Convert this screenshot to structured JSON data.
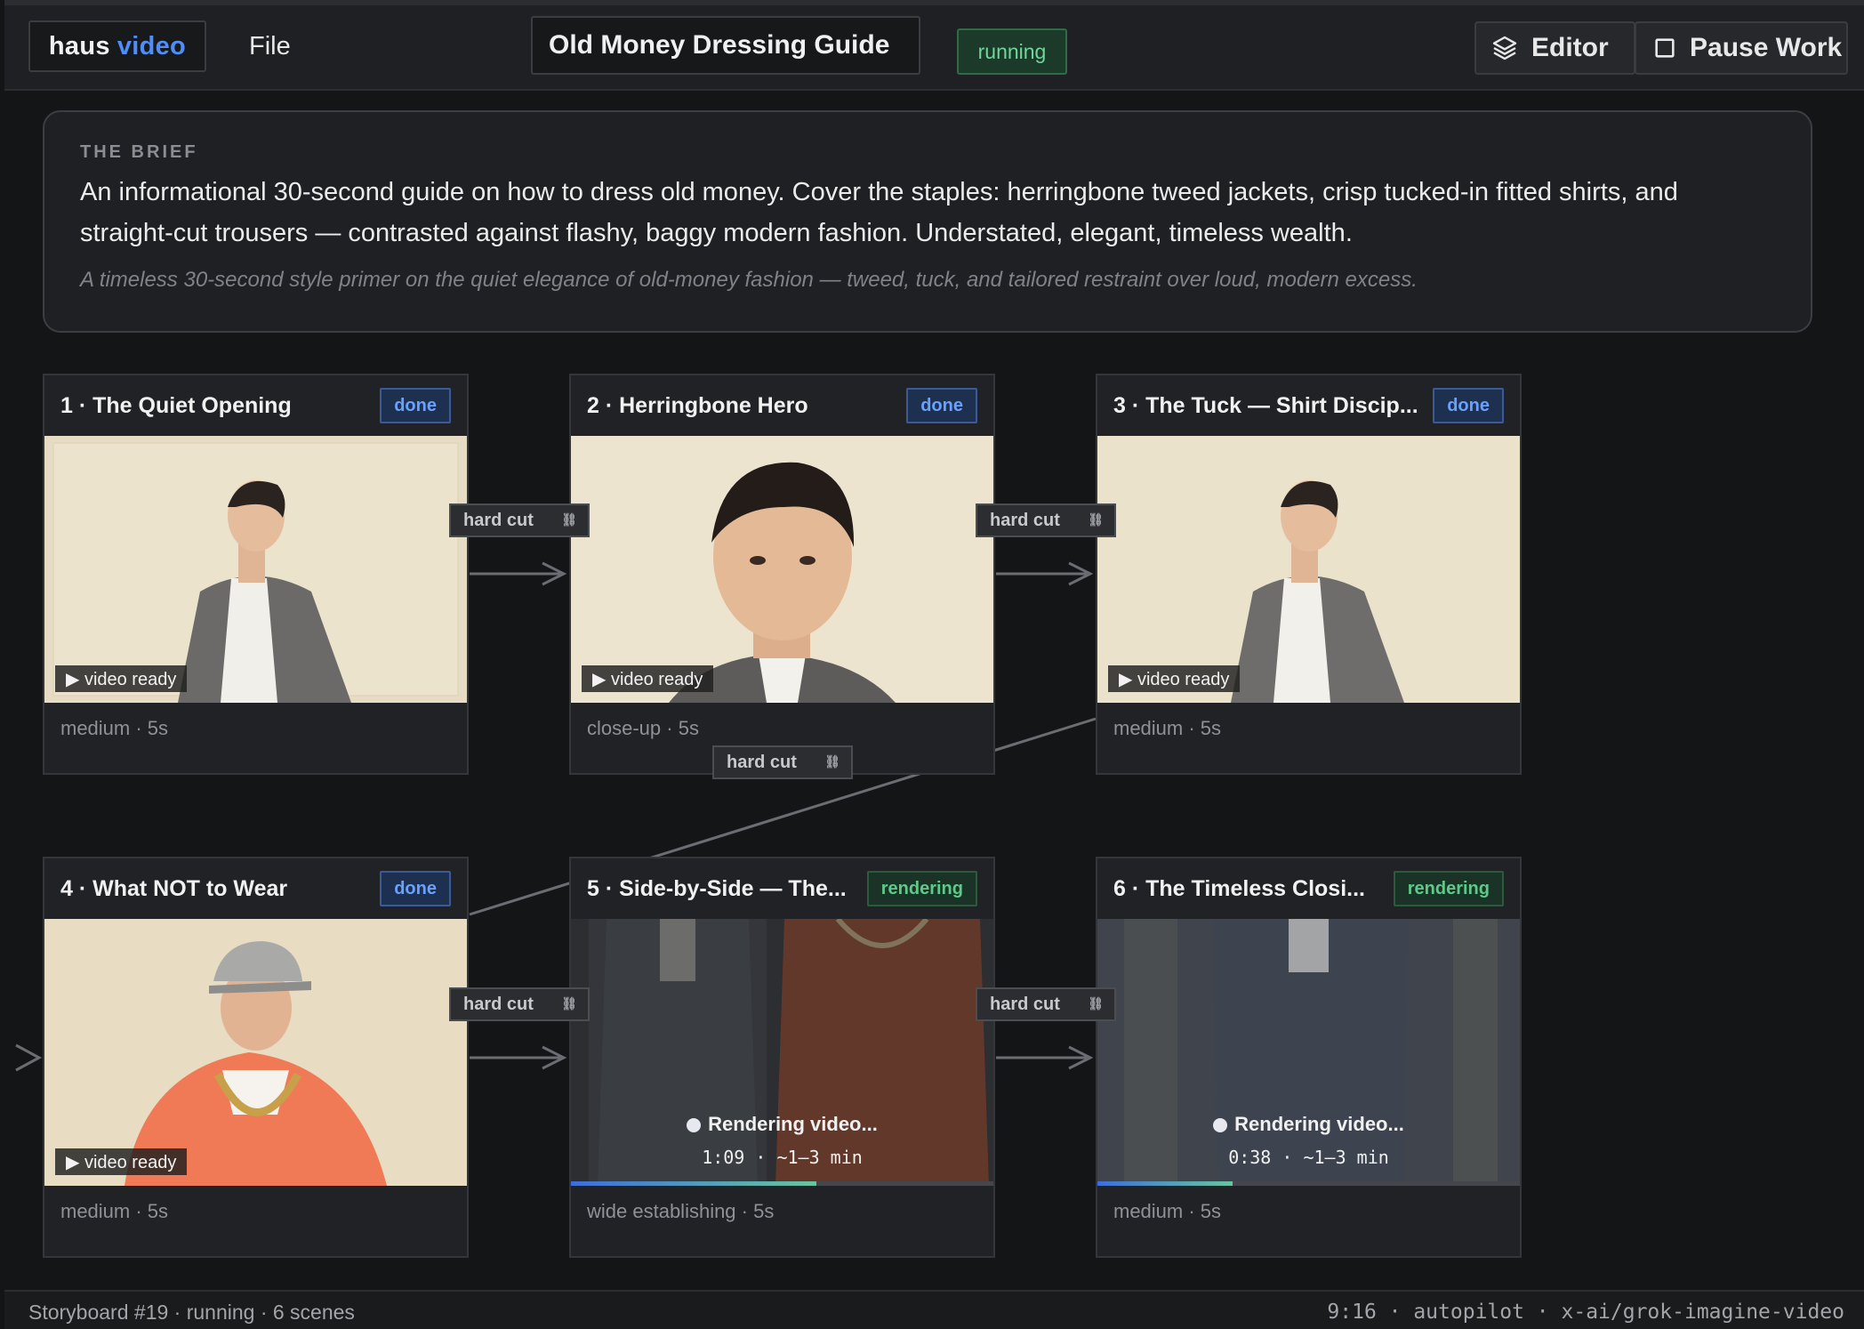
{
  "header": {
    "logo_a": "haus",
    "logo_b": "video",
    "menu_file": "File",
    "title": "Old Money Dressing Guide",
    "status": "running",
    "editor_label": "Editor",
    "pause_label": "Pause Work"
  },
  "brief": {
    "label": "THE BRIEF",
    "text": "An informational 30-second guide on how to dress old money. Cover the staples: herringbone tweed jackets, crisp tucked-in fitted shirts, and straight-cut trousers — contrasted against flashy, baggy modern fashion. Understated, elegant, timeless wealth.",
    "tagline": "A timeless 30-second style primer on the quiet elegance of old-money fashion — tweed, tuck, and tailored restraint over loud, modern excess."
  },
  "scenes": [
    {
      "title": "1 · The Quiet Opening",
      "status": "done",
      "overlay": "▶ video ready",
      "meta": "medium · 5s"
    },
    {
      "title": "2 · Herringbone Hero",
      "status": "done",
      "overlay": "▶ video ready",
      "meta": "close-up · 5s"
    },
    {
      "title": "3 · The Tuck — Shirt Discip...",
      "status": "done",
      "overlay": "▶ video ready",
      "meta": "medium · 5s"
    },
    {
      "title": "4 · What NOT to Wear",
      "status": "done",
      "overlay": "▶ video ready",
      "meta": "medium · 5s"
    },
    {
      "title": "5 · Side-by-Side — The...",
      "status": "rendering",
      "render_label": "Rendering video...",
      "render_time": "1:09 · ~1–3 min",
      "progress": 0.58,
      "meta": "wide establishing · 5s"
    },
    {
      "title": "6 · The Timeless Closi...",
      "status": "rendering",
      "render_label": "Rendering video...",
      "render_time": "0:38 · ~1–3 min",
      "progress": 0.32,
      "meta": "medium · 5s"
    }
  ],
  "transitions": [
    {
      "label": "hard cut",
      "icon": "link-icon"
    },
    {
      "label": "hard cut",
      "icon": "link-icon"
    },
    {
      "label": "hard cut",
      "icon": "link-icon"
    },
    {
      "label": "hard cut",
      "icon": "link-icon"
    },
    {
      "label": "hard cut",
      "icon": "link-icon"
    }
  ],
  "footer": {
    "left": "Storyboard #19 · running · 6 scenes",
    "right": "9:16 · autopilot · x-ai/grok-imagine-video"
  },
  "colors": {
    "accent_blue": "#4f8ef7",
    "done_badge": "#6aa1ff",
    "rendering_badge": "#5fc98a",
    "running_pill": "#6fd79a"
  }
}
